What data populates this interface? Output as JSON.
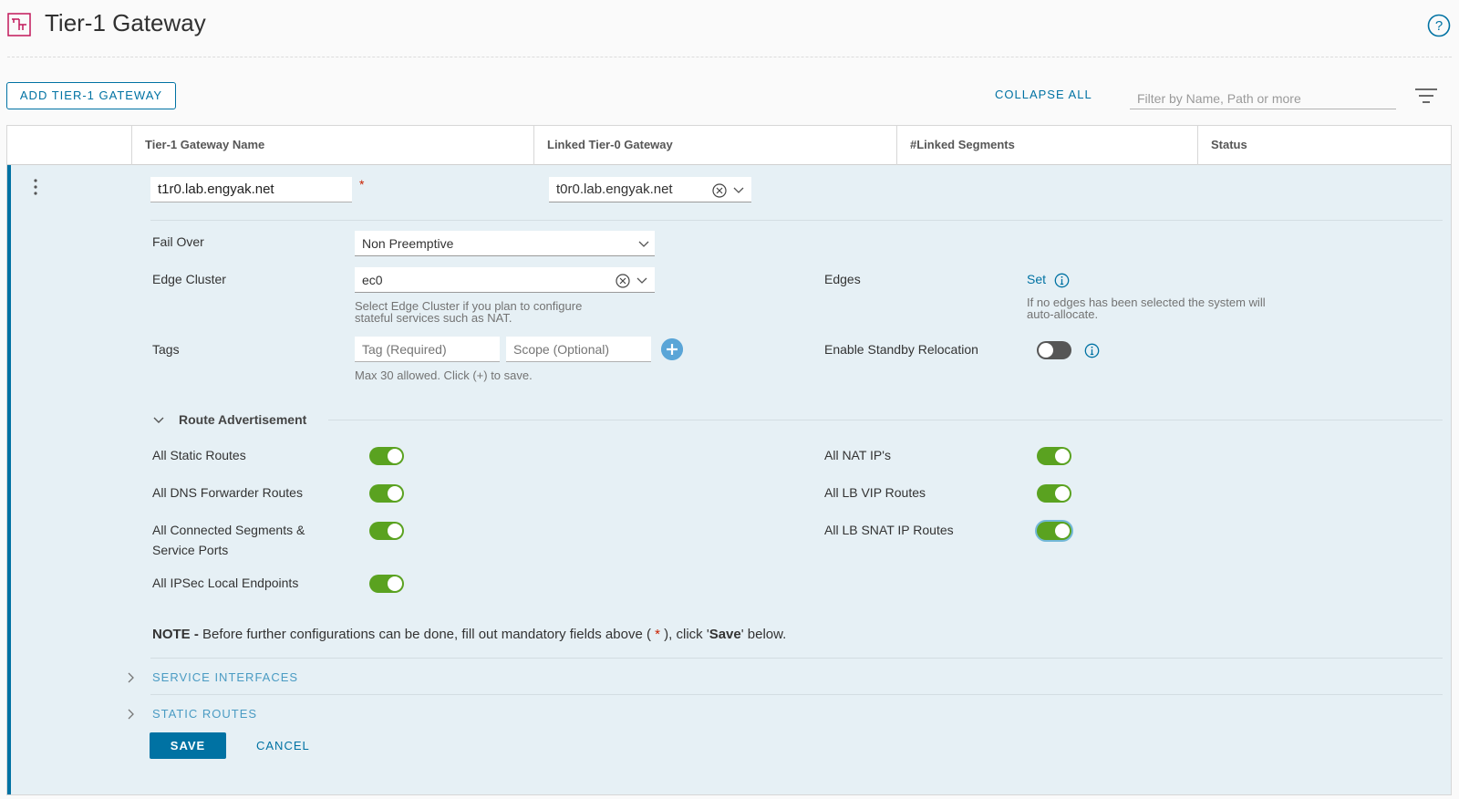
{
  "header": {
    "title": "Tier-1 Gateway",
    "icon": "gateway-icon",
    "help_icon": "help-icon"
  },
  "toolbar": {
    "add_label": "ADD TIER-1 GATEWAY",
    "collapse_all_label": "COLLAPSE ALL",
    "filter_placeholder": "Filter by Name, Path or more",
    "filter_icon": "filter-icon"
  },
  "table": {
    "columns": [
      "Tier-1 Gateway Name",
      "Linked Tier-0 Gateway",
      "#Linked Segments",
      "Status"
    ]
  },
  "row": {
    "name_value": "t1r0.lab.engyak.net",
    "required_mark": "*",
    "tier0_value": "t0r0.lab.engyak.net",
    "failover_label": "Fail Over",
    "failover_value": "Non Preemptive",
    "edge_cluster_label": "Edge Cluster",
    "edge_cluster_value": "ec0",
    "edge_cluster_hint_1": "Select Edge Cluster if you plan to configure",
    "edge_cluster_hint_2": "stateful services such as NAT.",
    "edges_label": "Edges",
    "edges_link": "Set",
    "edges_hint_1": "If no edges has been selected the system will",
    "edges_hint_2": "auto-allocate.",
    "tags_label": "Tags",
    "tag_placeholder": "Tag (Required)",
    "scope_placeholder": "Scope (Optional)",
    "tags_hint": "Max 30 allowed. Click (+) to save.",
    "standby_label": "Enable Standby Relocation",
    "standby_on": false,
    "route_adv_title": "Route Advertisement",
    "route_adv": {
      "static_routes": {
        "label": "All Static Routes",
        "on": true
      },
      "dns_forwarder": {
        "label": "All DNS Forwarder Routes",
        "on": true
      },
      "connected_1": "All Connected Segments &",
      "connected_2": "Service Ports",
      "connected_on": true,
      "ipsec": {
        "label": "All IPSec Local Endpoints",
        "on": true
      },
      "nat_ips": {
        "label": "All NAT IP's",
        "on": true
      },
      "lb_vip": {
        "label": "All LB VIP Routes",
        "on": true
      },
      "lb_snat": {
        "label": "All LB SNAT IP Routes",
        "on": true
      }
    },
    "note_bold": "NOTE -",
    "note_text_1": " Before further configurations can be done, fill out mandatory fields above ( ",
    "note_star": "*",
    "note_text_2": " ), click '",
    "note_save": "Save",
    "note_text_3": "' below.",
    "service_interfaces_label": "SERVICE INTERFACES",
    "static_routes_label": "STATIC ROUTES",
    "save_label": "SAVE",
    "cancel_label": "CANCEL"
  },
  "colors": {
    "accent": "#0072a3",
    "toggle_on": "#5aa220",
    "row_bg": "#e6f0f5",
    "required": "#c92100"
  }
}
